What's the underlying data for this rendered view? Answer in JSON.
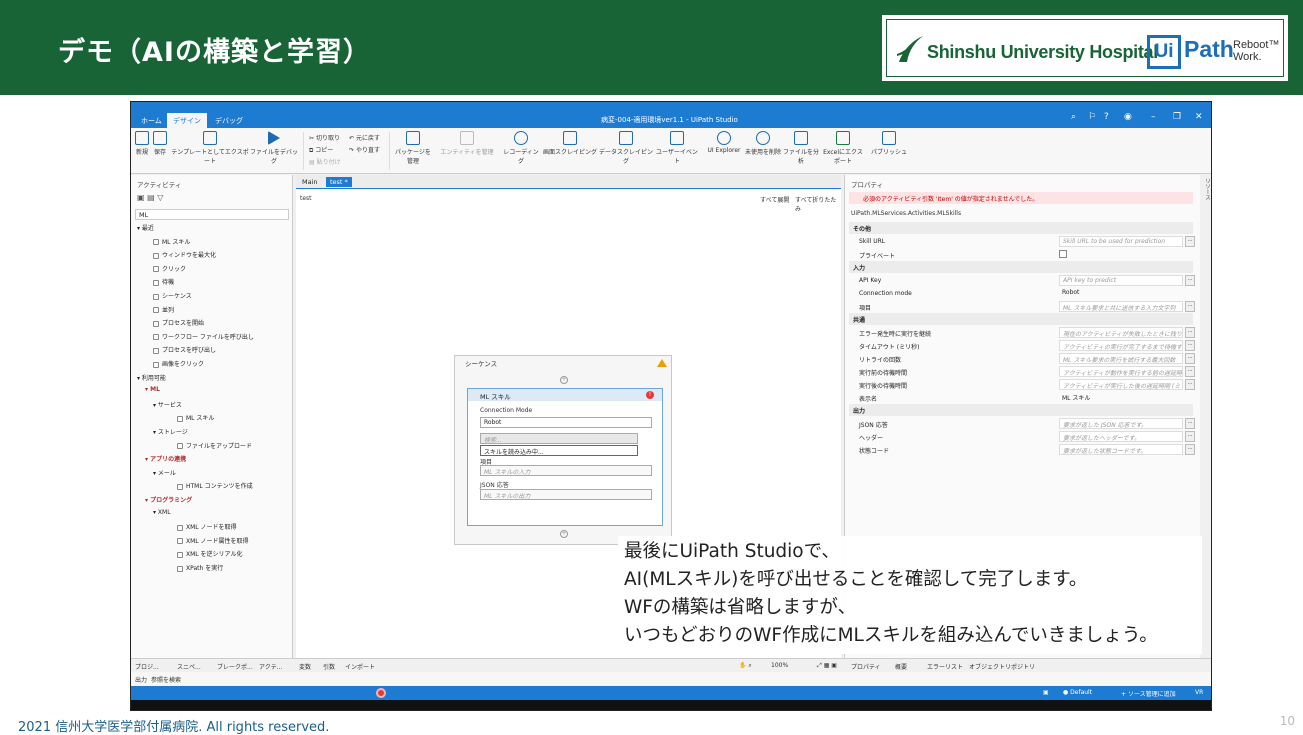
{
  "slide": {
    "title": "デモ（AIの構築と学習）",
    "footer": "2021 信州大学医学部付属病院. All rights reserved.",
    "page_number": "10",
    "logo_hospital": "Shinshu University Hospital",
    "logo_uipath_mark": "Ui",
    "logo_uipath_text": "Path",
    "logo_reboot_1": "Reboot™",
    "logo_reboot_2": "Work."
  },
  "studio": {
    "window_title": "病変-004-適用環境ver1.1 - UiPath Studio",
    "tabs": [
      "ホーム",
      "デザイン",
      "デバッグ"
    ],
    "ribbon": {
      "new": "新規",
      "save": "保存",
      "export_template": "テンプレートとしてエクスポート",
      "debug_file": "ファイルをデバッグ",
      "cut": "切り取り",
      "copy": "コピー",
      "paste": "貼り付け",
      "undo": "元に戻す",
      "redo": "やり直す",
      "manage_packages": "パッケージを管理",
      "manage_entities": "エンティティを管理",
      "recording": "レコーディング",
      "screen_scraping": "画面スクレイピング",
      "data_scraping": "データスクレイピング",
      "user_events": "ユーザーイベント",
      "ui_explorer": "UI Explorer",
      "remove_unused": "未使用を削除",
      "analyze_file": "ファイルを分析",
      "excel_export": "Excelにエクスポート",
      "publish": "パブリッシュ"
    },
    "activities_panel": {
      "header": "アクティビティ",
      "search_value": "ML",
      "items": [
        {
          "label": "最近",
          "level": 0
        },
        {
          "label": "ML スキル",
          "level": 2
        },
        {
          "label": "ウィンドウを最大化",
          "level": 2
        },
        {
          "label": "クリック",
          "level": 2
        },
        {
          "label": "待機",
          "level": 2
        },
        {
          "label": "シーケンス",
          "level": 2
        },
        {
          "label": "並列",
          "level": 2
        },
        {
          "label": "プロセスを開始",
          "level": 2
        },
        {
          "label": "ワークフロー ファイルを呼び出し",
          "level": 2
        },
        {
          "label": "プロセスを呼び出し",
          "level": 2
        },
        {
          "label": "画像をクリック",
          "level": 2
        },
        {
          "label": "利用可能",
          "level": 0
        },
        {
          "label": "ML",
          "level": 1
        },
        {
          "label": "サービス",
          "level": 2
        },
        {
          "label": "ML スキル",
          "level": 3
        },
        {
          "label": "ストレージ",
          "level": 2
        },
        {
          "label": "ファイルをアップロード",
          "level": 3
        },
        {
          "label": "アプリの連携",
          "level": 1
        },
        {
          "label": "メール",
          "level": 2
        },
        {
          "label": "HTML コンテンツを作成",
          "level": 3
        },
        {
          "label": "プログラミング",
          "level": 1
        },
        {
          "label": "XML",
          "level": 2
        },
        {
          "label": "XML ノードを取得",
          "level": 3
        },
        {
          "label": "XML ノード属性を取得",
          "level": 3
        },
        {
          "label": "XML を逆シリアル化",
          "level": 3
        },
        {
          "label": "XPath を実行",
          "level": 3
        }
      ]
    },
    "doc_tabs": [
      "Main",
      "test *"
    ],
    "breadcrumb": "test",
    "expand_all": "すべて展開",
    "collapse_all": "すべて折りたたみ",
    "sequence": {
      "title": "シーケンス",
      "activity_title": "ML スキル",
      "connection_mode_label": "Connection Mode",
      "connection_mode_value": "Robot",
      "skill_search_placeholder": "検索...",
      "loading_text": "スキルを読み込み中...",
      "item_label": "項目",
      "item_placeholder": "ML スキルの入力",
      "json_label": "JSON 応答",
      "json_placeholder": "ML スキルの出力"
    },
    "properties": {
      "header": "プロパティ",
      "error": "必須のアクティビティ引数 'Item' の値が指定されませんでした。",
      "type_name": "UiPath.MLServices.Activities.MLSkills",
      "sections": [
        {
          "title": "その他",
          "rows": [
            {
              "key": "Skill URL",
              "value": "Skill URL to be used for prediction",
              "kind": "input"
            },
            {
              "key": "プライベート",
              "value": "",
              "kind": "checkbox"
            }
          ]
        },
        {
          "title": "入力",
          "rows": [
            {
              "key": "API Key",
              "value": "API key to predict",
              "kind": "input"
            },
            {
              "key": "Connection mode",
              "value": "Robot",
              "kind": "plain"
            },
            {
              "key": "項目",
              "value": "ML スキル要求と共に送信する入力文字列",
              "kind": "input"
            }
          ]
        },
        {
          "title": "共通",
          "rows": [
            {
              "key": "エラー発生時に実行を継続",
              "value": "現在のアクティビティが失敗したときに残りの",
              "kind": "input"
            },
            {
              "key": "タイムアウト (ミリ秒)",
              "value": "アクティビティの実行が完了するまで待機する",
              "kind": "input"
            },
            {
              "key": "リトライの回数",
              "value": "ML スキル要求の実行を試行する最大回数",
              "kind": "input"
            },
            {
              "key": "実行前の待機時間",
              "value": "アクティビティが動作を実行する前の遅延時間",
              "kind": "input"
            },
            {
              "key": "実行後の待機時間",
              "value": "アクティビティが実行した後の遅延時間 (ミリ",
              "kind": "input"
            },
            {
              "key": "表示名",
              "value": "ML スキル",
              "kind": "plain"
            }
          ]
        },
        {
          "title": "出力",
          "rows": [
            {
              "key": "JSON 応答",
              "value": "要求が返した JSON 応答です。",
              "kind": "input"
            },
            {
              "key": "ヘッダー",
              "value": "要求が返したヘッダーです。",
              "kind": "input"
            },
            {
              "key": "状態コード",
              "value": "要求が返した状態コードです。",
              "kind": "input"
            }
          ]
        }
      ]
    },
    "side_tab": "リソース",
    "bottom_left_tabs": [
      "プロジ...",
      "スニペ...",
      "ブレークポ...",
      "アクテ..."
    ],
    "bottom_center_tabs": [
      "変数",
      "引数",
      "インポート"
    ],
    "zoom": "100%",
    "bottom_right_tabs": [
      "プロパティ",
      "概要",
      "エラーリスト",
      "オブジェクトリポジトリ"
    ],
    "output_tabs": [
      "出力",
      "参照を検索"
    ],
    "status": {
      "default": "Default",
      "source_control": "ソース管理に追加",
      "vr": "VR"
    }
  },
  "caption": {
    "lines": [
      "最後にUiPath Studioで、",
      "AI(MLスキル)を呼び出せることを確認して完了します。",
      "WFの構築は省略しますが、",
      "いつもどおりのWF作成にMLスキルを組み込んでいきましょう。"
    ]
  },
  "colors": {
    "header_green": "#186437",
    "studio_blue": "#1e7bd2",
    "error_red": "#e53935"
  }
}
